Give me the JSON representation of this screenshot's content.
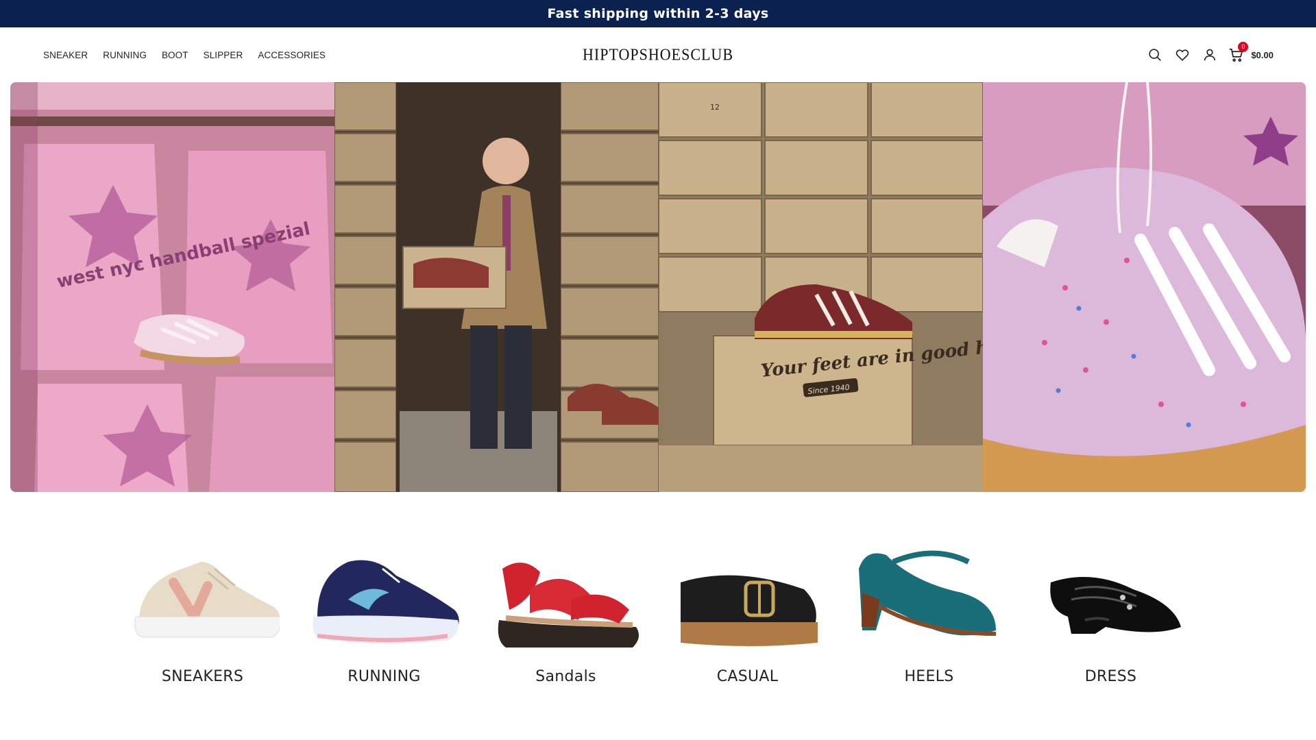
{
  "announcement": {
    "text": "Fast shipping within 2-3 days"
  },
  "header": {
    "nav": [
      "SNEAKER",
      "RUNNING",
      "BOOT",
      "SLIPPER",
      "ACCESSORIES"
    ],
    "logo_text": "HIPTOPSHOESCLUB",
    "icons": [
      "search-icon",
      "heart-icon",
      "user-icon",
      "cart-icon"
    ],
    "cart": {
      "count": "0",
      "total": "$0.00"
    }
  },
  "hero": {
    "panels": [
      {
        "name": "pink-sneaker-packs",
        "colors": [
          "#e8a9c4",
          "#d27aa6",
          "#f4cfe0"
        ],
        "bag_text": "west nyc handball spezial"
      },
      {
        "name": "shoebox-warehouse-man",
        "colors": [
          "#6f5a44",
          "#b8a07e",
          "#8a3d33"
        ]
      },
      {
        "name": "red-sneaker-on-boxes",
        "colors": [
          "#a89272",
          "#d8c4a2",
          "#7c2a2a"
        ],
        "box_text": "Your feet are in good hands",
        "box_subtext": "Since 1940",
        "box_size": "12"
      },
      {
        "name": "knit-sneaker-closeup",
        "colors": [
          "#d9b5d8",
          "#c28bc0",
          "#d9a25e"
        ]
      }
    ]
  },
  "categories": [
    {
      "label": "SNEAKERS",
      "icon": "beige-sneaker-icon"
    },
    {
      "label": "RUNNING",
      "icon": "navy-running-shoe-icon"
    },
    {
      "label": "Sandals",
      "icon": "red-sandal-icon"
    },
    {
      "label": "CASUAL",
      "icon": "black-clog-icon"
    },
    {
      "label": "HEELS",
      "icon": "teal-heel-icon"
    },
    {
      "label": "DRESS",
      "icon": "patent-dress-shoe-icon"
    }
  ]
}
